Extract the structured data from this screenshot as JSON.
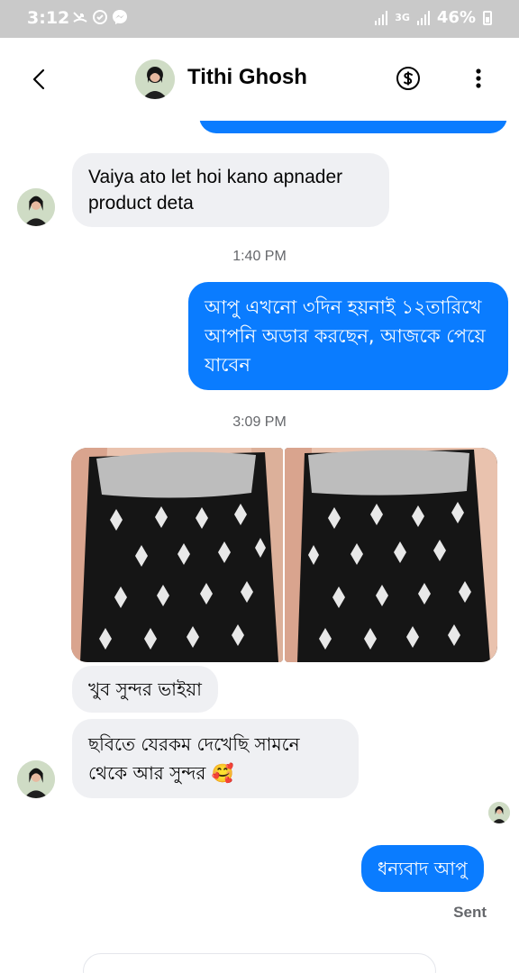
{
  "status_bar": {
    "time": "3:12",
    "network": "3G",
    "battery": "46%"
  },
  "header": {
    "contact_name": "Tithi Ghosh",
    "icons": [
      "back-arrow-icon",
      "dollar-icon",
      "more-vertical-icon"
    ]
  },
  "messages": {
    "incoming_1": "Vaiya ato let hoi kano apnader product deta",
    "timestamp_1": "1:40 PM",
    "outgoing_1": "আপু এখনো ৩দিন হয়নাই ১২তারিখে আপনি অডার করছেন, আজকে পেয়ে যাবেন",
    "timestamp_2": "3:09 PM",
    "incoming_2": "খুব সুন্দর ভাইয়া",
    "incoming_3_line1": "ছবিতে যেরকম দেখেছি সামনে",
    "incoming_3_line2": "থেকে আর সুন্দর 🥰",
    "outgoing_2": "ধন্যবাদ আপু",
    "sent_status": "Sent"
  },
  "photos": [
    "black-embroidered-dress-photo",
    "black-embroidered-dress-photo"
  ],
  "colors": {
    "outgoing_bubble": "#0a7cff",
    "incoming_bubble": "#eff0f3",
    "status_bar": "#c9c9c9"
  }
}
